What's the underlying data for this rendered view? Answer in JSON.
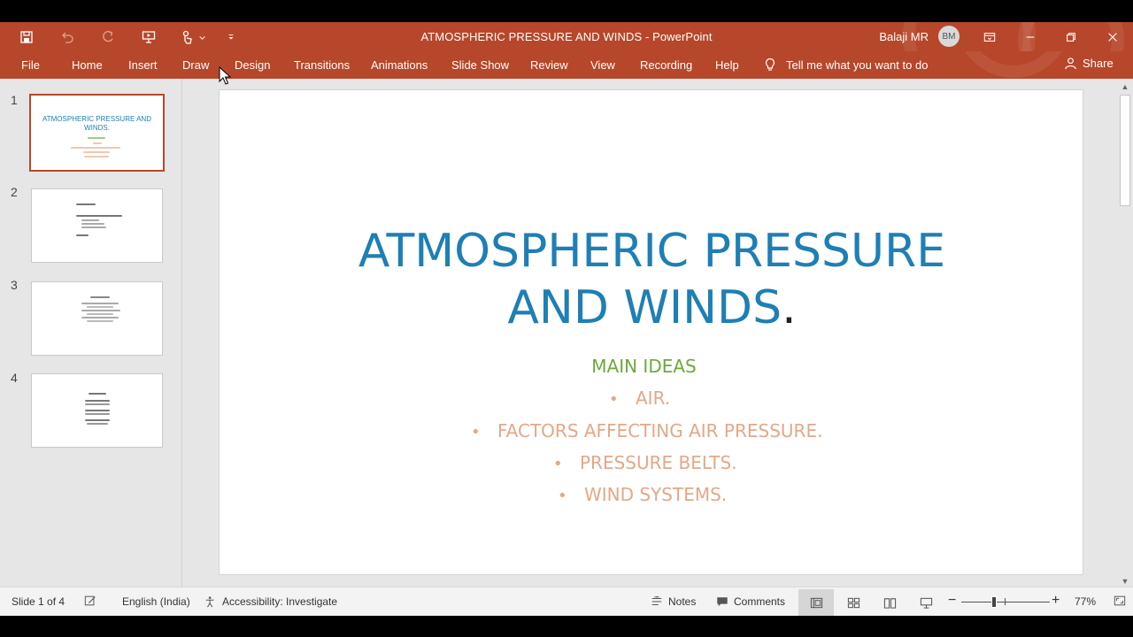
{
  "app": {
    "title": "ATMOSPHERIC PRESSURE AND WINDS  -  PowerPoint",
    "user_name": "Balaji MR",
    "avatar_initials": "BM",
    "accent_color": "#b7472a"
  },
  "ribbon": {
    "tabs": [
      "File",
      "Home",
      "Insert",
      "Draw",
      "Design",
      "Transitions",
      "Animations",
      "Slide Show",
      "Review",
      "View",
      "Recording",
      "Help"
    ],
    "tell_me": "Tell me what you want to do",
    "share": "Share"
  },
  "thumbnails": {
    "numbers": [
      "1",
      "2",
      "3",
      "4"
    ],
    "slide1_title": "ATMOSPHERIC PRESSURE AND WINDS.",
    "selected": "1"
  },
  "slide": {
    "title_line1": "ATMOSPHERIC PRESSURE",
    "title_line2": "AND WINDS",
    "title_dot": ".",
    "subtitle": "MAIN IDEAS",
    "bullets": [
      "AIR.",
      "FACTORS AFFECTING AIR PRESSURE.",
      "PRESSURE BELTS.",
      "WIND SYSTEMS."
    ],
    "bullet_char": "•",
    "title_color": "#1e7fb5",
    "subtitle_color": "#6aaa3b",
    "bullet_color": "#e3a887"
  },
  "status": {
    "slide_indicator": "Slide 1 of 4",
    "language": "English (India)",
    "accessibility": "Accessibility: Investigate",
    "notes": "Notes",
    "comments": "Comments",
    "zoom": "77%"
  }
}
